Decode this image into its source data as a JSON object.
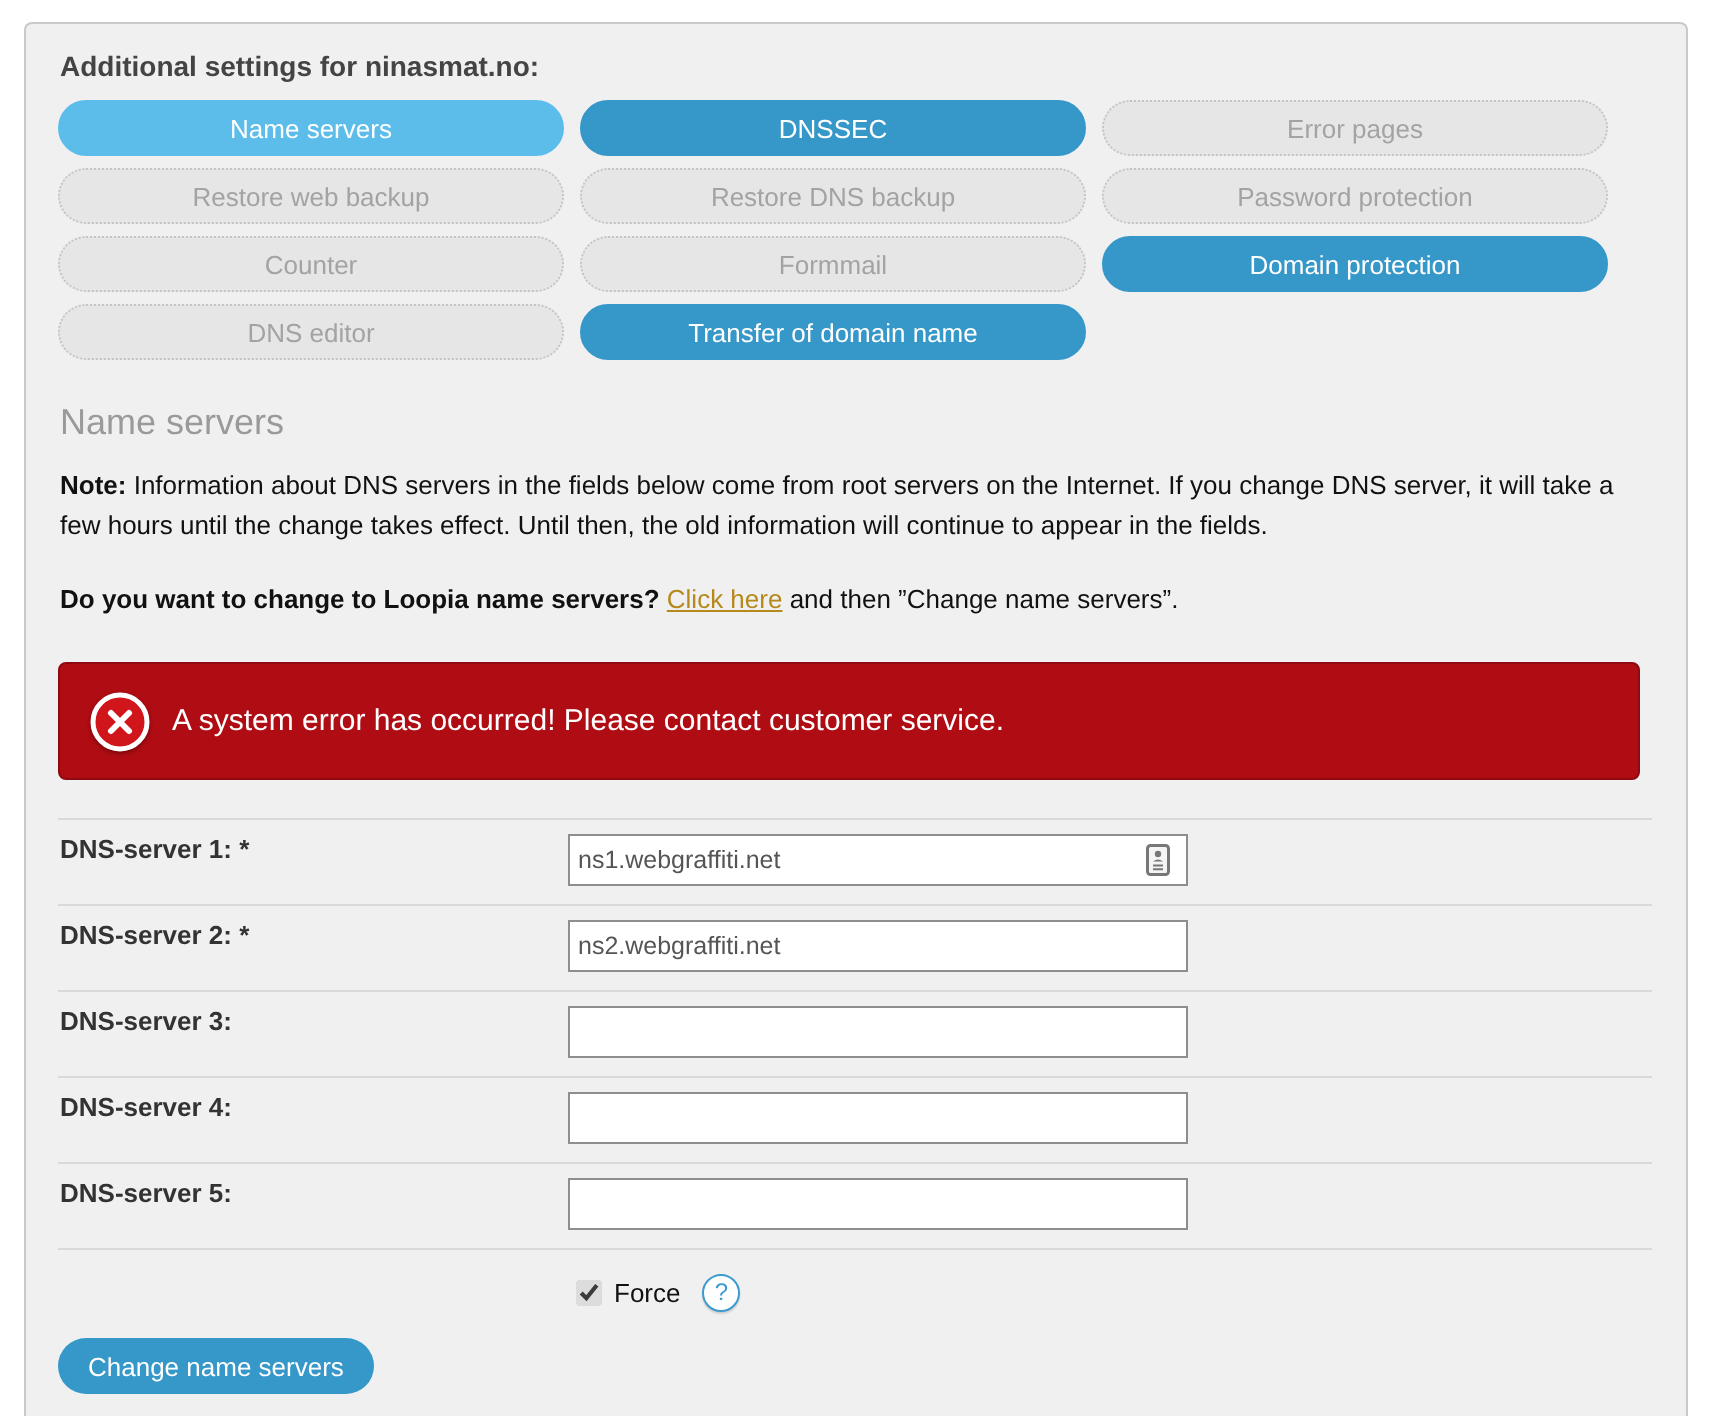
{
  "panel": {
    "title": "Additional settings for ninasmat.no:"
  },
  "settings_buttons": [
    {
      "label": "Name servers",
      "selected": true,
      "disabled": false
    },
    {
      "label": "DNSSEC",
      "selected": false,
      "disabled": false
    },
    {
      "label": "Error pages",
      "selected": false,
      "disabled": true
    },
    {
      "label": "Restore web backup",
      "selected": false,
      "disabled": true
    },
    {
      "label": "Restore DNS backup",
      "selected": false,
      "disabled": true
    },
    {
      "label": "Password protection",
      "selected": false,
      "disabled": true
    },
    {
      "label": "Counter",
      "selected": false,
      "disabled": true
    },
    {
      "label": "Formmail",
      "selected": false,
      "disabled": true
    },
    {
      "label": "Domain protection",
      "selected": false,
      "disabled": false
    },
    {
      "label": "DNS editor",
      "selected": false,
      "disabled": true
    },
    {
      "label": "Transfer of domain name",
      "selected": false,
      "disabled": false
    }
  ],
  "section": {
    "heading": "Name servers",
    "note": "**Note:** Information about DNS servers in the fields below come from root servers on the Internet. If you change DNS server, it will take a few hours until the change takes effect. Until then, the old information will continue to appear in the fields.",
    "question": "**Do you want to change to Loopia name servers?** ",
    "link": "Click here",
    "after_link": " and then ”Change name servers”."
  },
  "error": {
    "message": "A system error has occurred! Please contact customer service."
  },
  "fields": [
    {
      "label": "DNS-server 1: *",
      "value": "ns1.webgraffiti.net",
      "autofill_icon": true
    },
    {
      "label": "DNS-server 2: *",
      "value": "ns2.webgraffiti.net",
      "autofill_icon": false
    },
    {
      "label": "DNS-server 3:",
      "autofill_icon": false
    },
    {
      "label": "DNS-server 4:",
      "autofill_icon": false
    },
    {
      "label": "DNS-server 5:",
      "autofill_icon": false
    }
  ],
  "force": {
    "label": "Force",
    "checked": true,
    "help": "?"
  },
  "submit": "Change name servers"
}
